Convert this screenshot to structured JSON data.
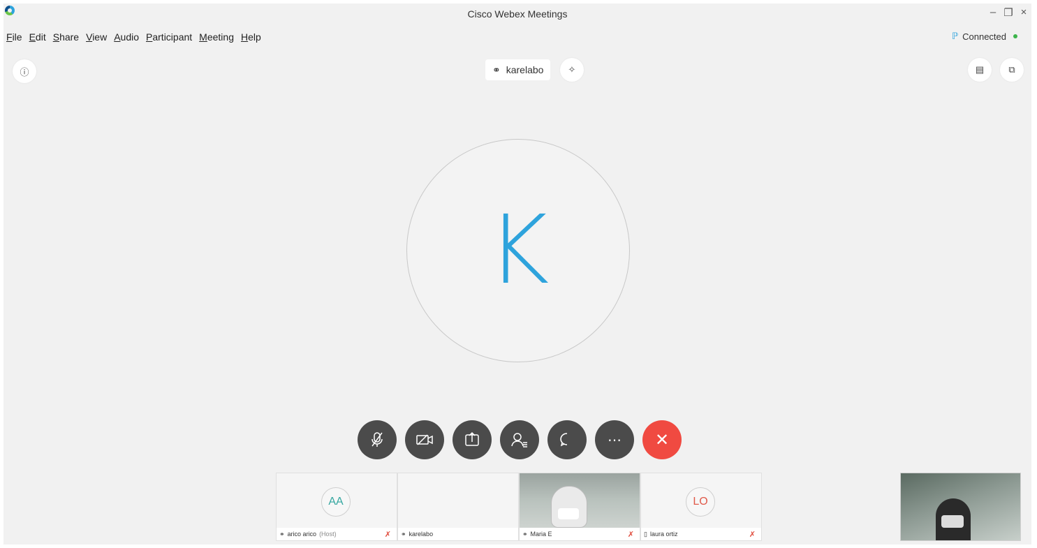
{
  "window": {
    "title": "Cisco Webex Meetings",
    "minimize": "–",
    "restore": "❐",
    "close": "×"
  },
  "menu": [
    {
      "u": "F",
      "rest": "ile"
    },
    {
      "u": "E",
      "rest": "dit"
    },
    {
      "u": "S",
      "rest": "hare"
    },
    {
      "u": "V",
      "rest": "iew"
    },
    {
      "u": "A",
      "rest": "udio"
    },
    {
      "u": "P",
      "rest": "articipant"
    },
    {
      "u": "M",
      "rest": "eeting"
    },
    {
      "u": "H",
      "rest": "elp"
    }
  ],
  "status": {
    "label": "Connected",
    "color": "#3cb44b"
  },
  "active_speaker": {
    "name": "karelabo",
    "initial": "K",
    "avatar_color": "#2ea3dc"
  },
  "controls": [
    {
      "name": "mute-button",
      "icon": "microphone-muted-icon",
      "glyph": "🎙"
    },
    {
      "name": "video-button",
      "icon": "video-off-icon",
      "glyph": "⊠"
    },
    {
      "name": "share-button",
      "icon": "share-icon",
      "glyph": "⇪"
    },
    {
      "name": "participants-button",
      "icon": "participants-icon",
      "glyph": "👤"
    },
    {
      "name": "chat-button",
      "icon": "chat-icon",
      "glyph": "💬"
    },
    {
      "name": "more-button",
      "icon": "more-icon",
      "glyph": "⋯"
    },
    {
      "name": "end-meeting-button",
      "icon": "close-icon",
      "glyph": "✕"
    }
  ],
  "participants": [
    {
      "name": "arico arico",
      "role": "(Host)",
      "initials": "AA",
      "initials_color": "#35a7a0",
      "muted": true
    },
    {
      "name": "karelabo",
      "role": "",
      "initials": "",
      "muted": false
    },
    {
      "name": "Maria E",
      "role": "",
      "initials": "",
      "muted": true,
      "video": true
    },
    {
      "name": "laura ortiz",
      "role": "",
      "initials": "LO",
      "initials_color": "#e05a4a",
      "muted": true
    }
  ]
}
